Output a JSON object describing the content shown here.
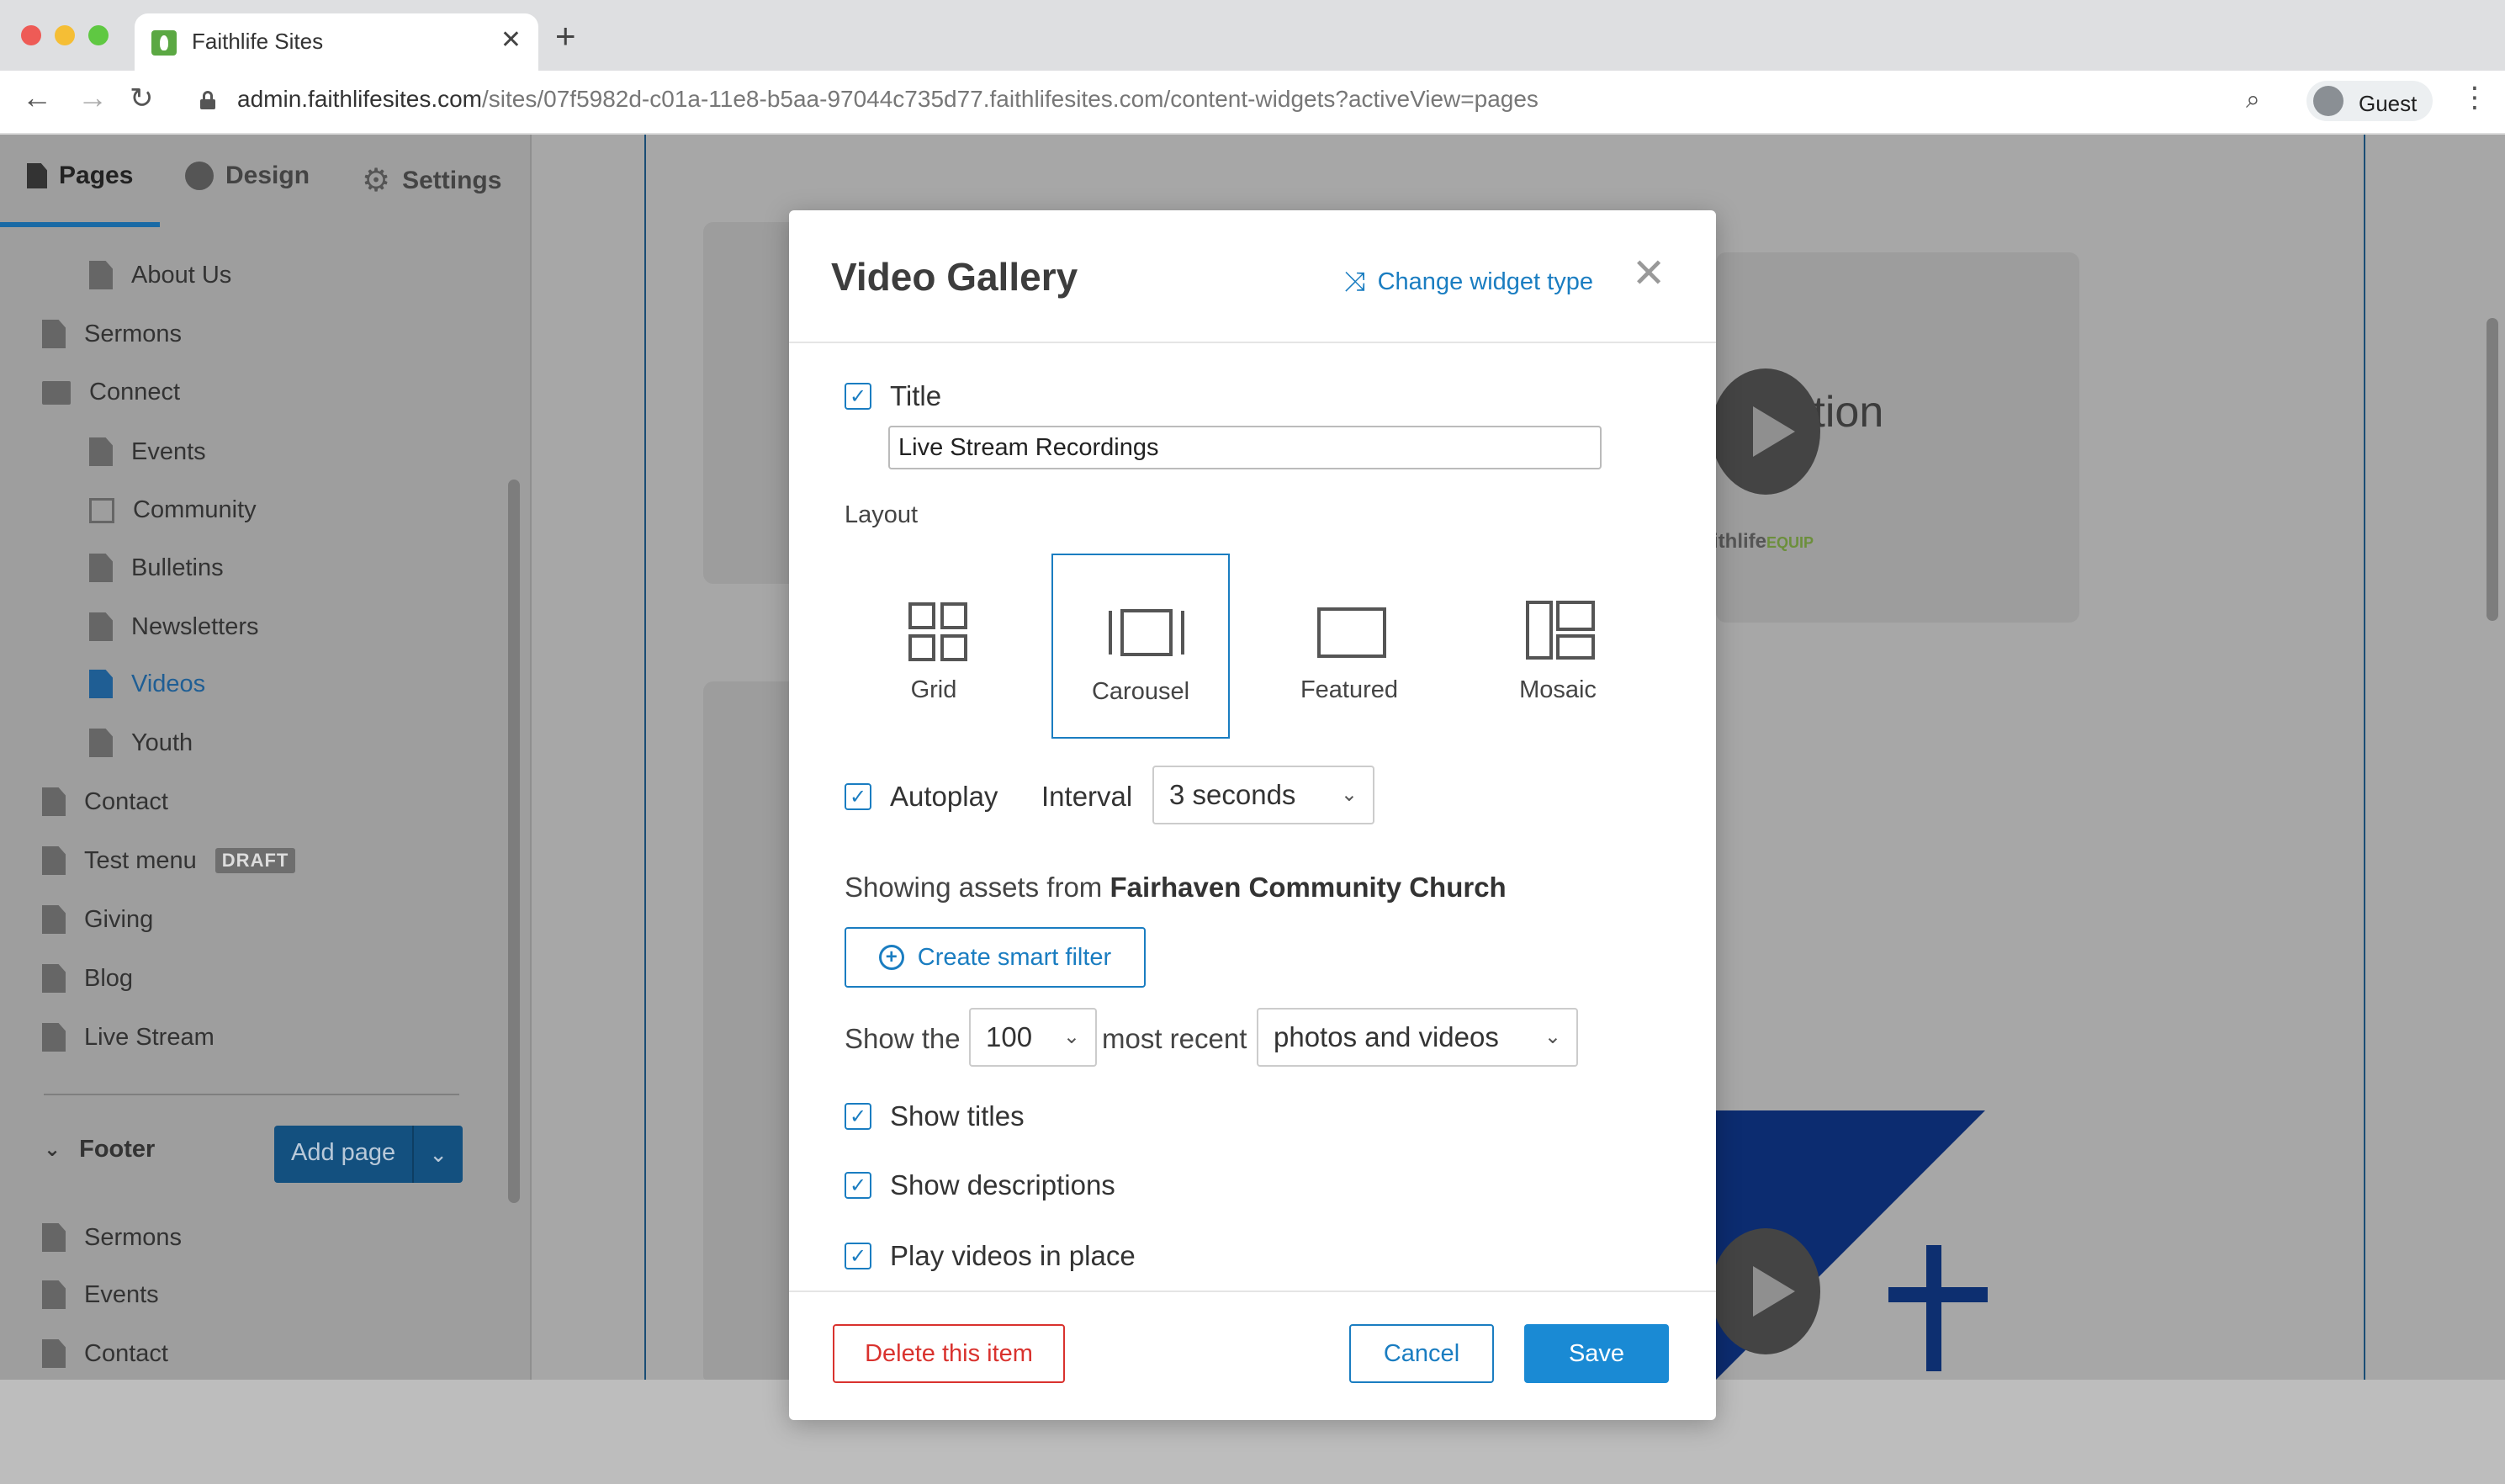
{
  "browser": {
    "tab_title": "Faithlife Sites",
    "url_host": "admin.faithlifesites.com",
    "url_path": "/sites/07f5982d-c01a-11e8-b5aa-97044c735d77.faithlifesites.com/content-widgets?activeView=pages",
    "profile_label": "Guest"
  },
  "sidebar": {
    "tabs": [
      {
        "label": "Pages",
        "icon": "page-icon"
      },
      {
        "label": "Design",
        "icon": "palette-icon"
      },
      {
        "label": "Settings",
        "icon": "gear-icon"
      }
    ],
    "pages": [
      {
        "label": "About Us"
      },
      {
        "label": "Sermons"
      },
      {
        "label": "Connect"
      },
      {
        "label": "Events"
      },
      {
        "label": "Community"
      },
      {
        "label": "Bulletins"
      },
      {
        "label": "Newsletters"
      },
      {
        "label": "Videos"
      },
      {
        "label": "Youth"
      },
      {
        "label": "Contact"
      },
      {
        "label": "Test menu",
        "badge": "DRAFT"
      },
      {
        "label": "Giving"
      },
      {
        "label": "Blog"
      },
      {
        "label": "Live Stream"
      }
    ],
    "footer_label": "Footer",
    "add_page_label": "Add page",
    "footer_pages": [
      {
        "label": "Sermons"
      },
      {
        "label": "Events"
      },
      {
        "label": "Contact"
      }
    ]
  },
  "background": {
    "fragment_text": "nication",
    "brand_text": "ithlife",
    "brand_suffix": "EQUIP"
  },
  "modal": {
    "title": "Video Gallery",
    "change_type_label": "Change widget type",
    "title_checkbox_label": "Title",
    "title_value": "Live Stream Recordings",
    "layout_label": "Layout",
    "layout_options": [
      {
        "label": "Grid"
      },
      {
        "label": "Carousel",
        "selected": true
      },
      {
        "label": "Featured"
      },
      {
        "label": "Mosaic"
      }
    ],
    "autoplay_label": "Autoplay",
    "interval_label": "Interval",
    "interval_value": "3 seconds",
    "showing_prefix": "Showing assets from",
    "showing_source": "Fairhaven Community Church",
    "smart_filter_label": "Create smart filter",
    "show_the_label": "Show the",
    "count_value": "100",
    "most_recent_label": "most recent",
    "media_type_value": "photos and videos",
    "show_titles_label": "Show titles",
    "show_descriptions_label": "Show descriptions",
    "play_in_place_label": "Play videos in place",
    "delete_label": "Delete this item",
    "cancel_label": "Cancel",
    "save_label": "Save"
  },
  "colors": {
    "accent": "#1a7dc1",
    "save_bg": "#1a8ad4",
    "danger": "#d9322e",
    "overlay": "#a7a7a7"
  }
}
